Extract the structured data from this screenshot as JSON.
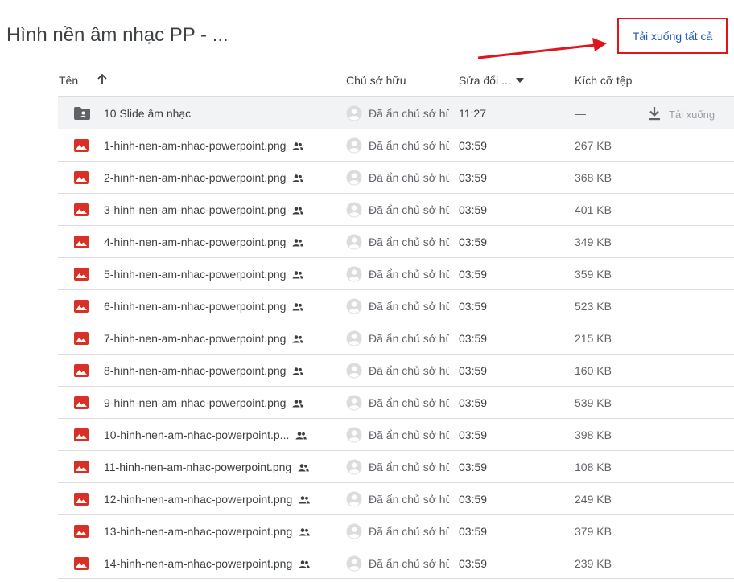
{
  "title": "Hình nền âm nhạc PP - ...",
  "download_all_label": "Tải xuống tất cả",
  "columns": {
    "name": "Tên",
    "owner": "Chủ sở hữu",
    "modified": "Sửa đổi ...",
    "size": "Kích cỡ tệp"
  },
  "icons": {
    "folder": "folder-shared-icon",
    "image": "image-file-icon",
    "shared": "people-icon",
    "avatar": "account-circle-icon",
    "sort": "arrow-up-icon",
    "download": "download-icon"
  },
  "colors": {
    "image_icon": "#d93025",
    "folder_icon": "#5f6368",
    "link": "#1a56c4",
    "annotation": "#e1141b"
  },
  "rows": [
    {
      "name": "10 Slide âm nhạc",
      "owner": "Đã ẩn chủ sở hữu",
      "modified": "11:27",
      "size": "—",
      "type": "folder",
      "action": "Tải xuống"
    },
    {
      "name": "1-hinh-nen-am-nhac-powerpoint.png",
      "owner": "Đã ẩn chủ sở hữu",
      "modified": "03:59",
      "size": "267 KB",
      "type": "image"
    },
    {
      "name": "2-hinh-nen-am-nhac-powerpoint.png",
      "owner": "Đã ẩn chủ sở hữu",
      "modified": "03:59",
      "size": "368 KB",
      "type": "image"
    },
    {
      "name": "3-hinh-nen-am-nhac-powerpoint.png",
      "owner": "Đã ẩn chủ sở hữu",
      "modified": "03:59",
      "size": "401 KB",
      "type": "image"
    },
    {
      "name": "4-hinh-nen-am-nhac-powerpoint.png",
      "owner": "Đã ẩn chủ sở hữu",
      "modified": "03:59",
      "size": "349 KB",
      "type": "image"
    },
    {
      "name": "5-hinh-nen-am-nhac-powerpoint.png",
      "owner": "Đã ẩn chủ sở hữu",
      "modified": "03:59",
      "size": "359 KB",
      "type": "image"
    },
    {
      "name": "6-hinh-nen-am-nhac-powerpoint.png",
      "owner": "Đã ẩn chủ sở hữu",
      "modified": "03:59",
      "size": "523 KB",
      "type": "image"
    },
    {
      "name": "7-hinh-nen-am-nhac-powerpoint.png",
      "owner": "Đã ẩn chủ sở hữu",
      "modified": "03:59",
      "size": "215 KB",
      "type": "image"
    },
    {
      "name": "8-hinh-nen-am-nhac-powerpoint.png",
      "owner": "Đã ẩn chủ sở hữu",
      "modified": "03:59",
      "size": "160 KB",
      "type": "image"
    },
    {
      "name": "9-hinh-nen-am-nhac-powerpoint.png",
      "owner": "Đã ẩn chủ sở hữu",
      "modified": "03:59",
      "size": "539 KB",
      "type": "image"
    },
    {
      "name": "10-hinh-nen-am-nhac-powerpoint.p...",
      "owner": "Đã ẩn chủ sở hữu",
      "modified": "03:59",
      "size": "398 KB",
      "type": "image"
    },
    {
      "name": "11-hinh-nen-am-nhac-powerpoint.png",
      "owner": "Đã ẩn chủ sở hữu",
      "modified": "03:59",
      "size": "108 KB",
      "type": "image"
    },
    {
      "name": "12-hinh-nen-am-nhac-powerpoint.png",
      "owner": "Đã ẩn chủ sở hữu",
      "modified": "03:59",
      "size": "249 KB",
      "type": "image"
    },
    {
      "name": "13-hinh-nen-am-nhac-powerpoint.png",
      "owner": "Đã ẩn chủ sở hữu",
      "modified": "03:59",
      "size": "379 KB",
      "type": "image"
    },
    {
      "name": "14-hinh-nen-am-nhac-powerpoint.png",
      "owner": "Đã ẩn chủ sở hữu",
      "modified": "03:59",
      "size": "239 KB",
      "type": "image"
    }
  ]
}
